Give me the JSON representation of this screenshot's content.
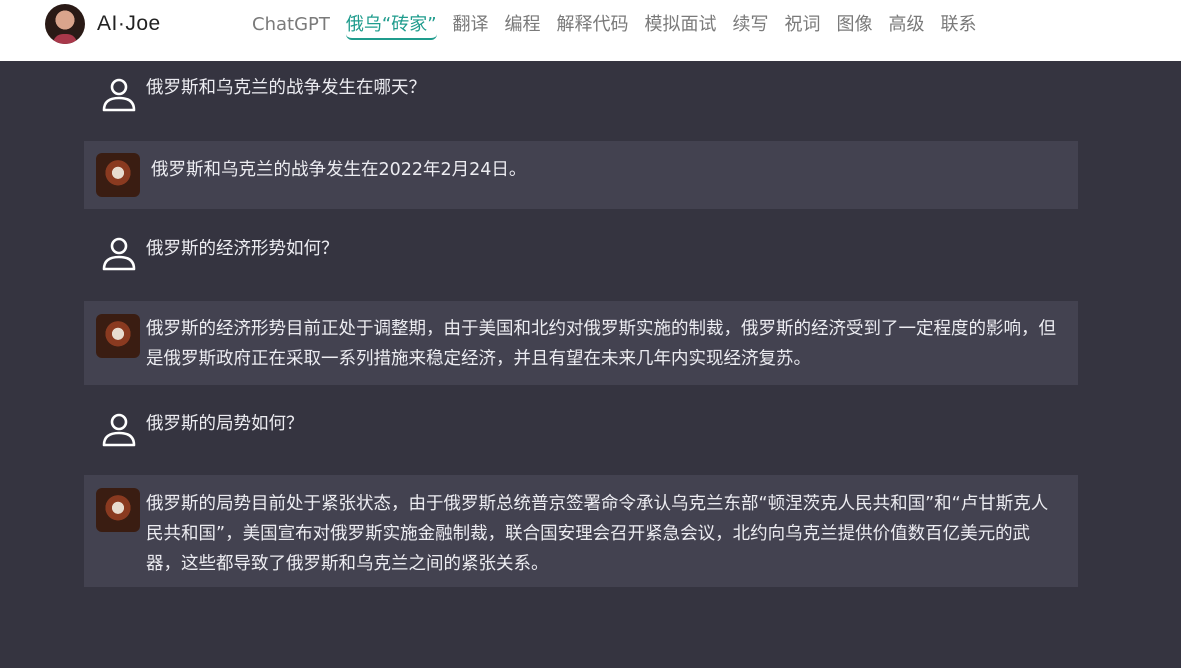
{
  "header": {
    "brand_name": "AI·Joe",
    "nav": [
      {
        "label": "ChatGPT",
        "active": false
      },
      {
        "label": "俄乌“砖家”",
        "active": true
      },
      {
        "label": "翻译",
        "active": false
      },
      {
        "label": "编程",
        "active": false
      },
      {
        "label": "解释代码",
        "active": false
      },
      {
        "label": "模拟面试",
        "active": false
      },
      {
        "label": "续写",
        "active": false
      },
      {
        "label": "祝词",
        "active": false
      },
      {
        "label": "图像",
        "active": false
      },
      {
        "label": "高级",
        "active": false
      },
      {
        "label": "联系",
        "active": false
      }
    ]
  },
  "messages": [
    {
      "role": "user",
      "text": "俄罗斯和乌克兰的战争发生在哪天？"
    },
    {
      "role": "bot",
      "text": "俄罗斯和乌克兰的战争发生在2022年2月24日。"
    },
    {
      "role": "user",
      "text": "俄罗斯的经济形势如何？"
    },
    {
      "role": "bot",
      "text": "俄罗斯的经济形势目前正处于调整期，由于美国和北约对俄罗斯实施的制裁，俄罗斯的经济受到了一定程度的影响，但是俄罗斯政府正在采取一系列措施来稳定经济，并且有望在未来几年内实现经济复苏。"
    },
    {
      "role": "user",
      "text": "俄罗斯的局势如何？"
    },
    {
      "role": "bot",
      "text": "俄罗斯的局势目前处于紧张状态，由于俄罗斯总统普京签署命令承认乌克兰东部“顿涅茨克人民共和国”和“卢甘斯克人民共和国”，美国宣布对俄罗斯实施金融制裁，联合国安理会召开紧急会议，北约向乌克兰提供价值数百亿美元的武器，这些都导致了俄罗斯和乌克兰之间的紧张关系。"
    }
  ],
  "colors": {
    "accent": "#1f9c8d",
    "background": "#353440",
    "bot_bubble": "#434250",
    "text": "#ececf1"
  },
  "icons": {
    "user": "user-icon",
    "bot": "bot-avatar"
  }
}
